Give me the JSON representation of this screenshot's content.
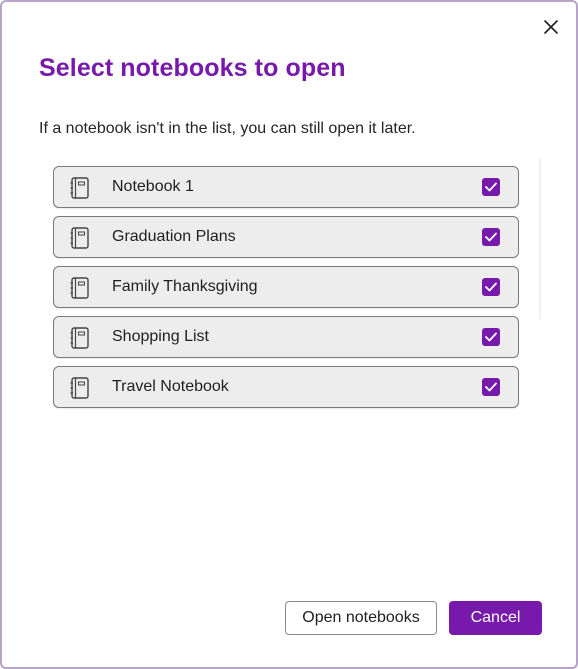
{
  "dialog": {
    "title": "Select notebooks to open",
    "subtitle": "If a notebook isn't in the list, you can still open it later.",
    "close_icon": "close-icon"
  },
  "notebooks": [
    {
      "label": "Notebook 1",
      "checked": true,
      "icon": "notebook-icon"
    },
    {
      "label": "Graduation Plans",
      "checked": true,
      "icon": "notebook-icon"
    },
    {
      "label": "Family Thanksgiving",
      "checked": true,
      "icon": "notebook-icon"
    },
    {
      "label": "Shopping List",
      "checked": true,
      "icon": "notebook-icon"
    },
    {
      "label": "Travel Notebook",
      "checked": true,
      "icon": "notebook-icon"
    }
  ],
  "buttons": {
    "open_label": "Open notebooks",
    "cancel_label": "Cancel"
  },
  "colors": {
    "accent": "#7719aa",
    "item_background": "#ededed",
    "item_border": "#7a7a7a"
  }
}
